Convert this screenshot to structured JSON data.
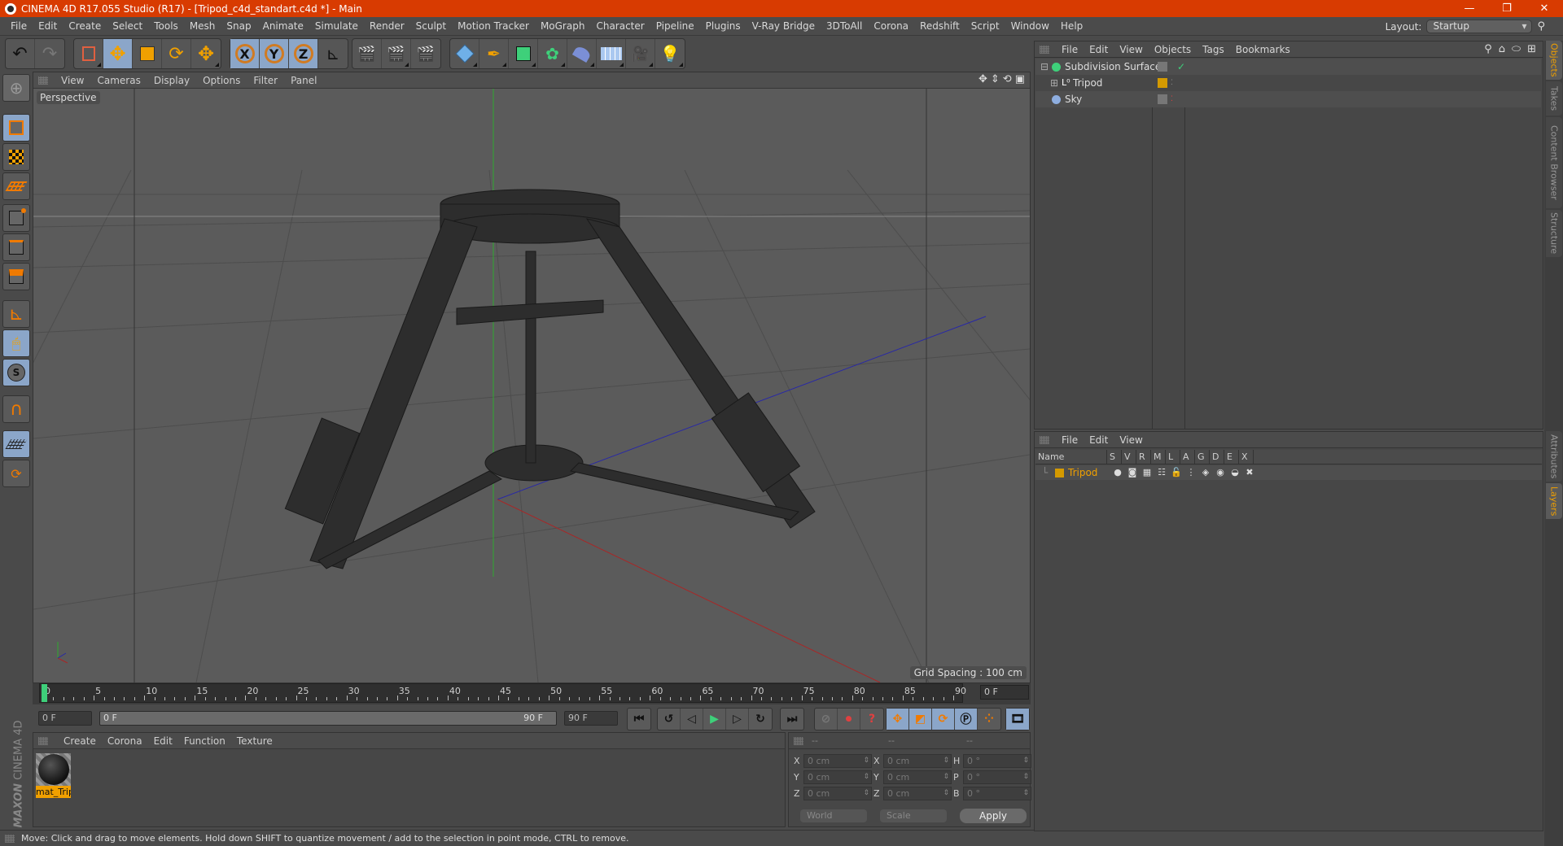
{
  "title": "CINEMA 4D R17.055 Studio (R17) - [Tripod_c4d_standart.c4d *] - Main",
  "window_controls": {
    "minimize": "—",
    "maximize": "❐",
    "close": "✕"
  },
  "menubar": [
    "File",
    "Edit",
    "Create",
    "Select",
    "Tools",
    "Mesh",
    "Snap",
    "Animate",
    "Simulate",
    "Render",
    "Sculpt",
    "Motion Tracker",
    "MoGraph",
    "Character",
    "Pipeline",
    "Plugins",
    "V-Ray Bridge",
    "3DToAll",
    "Corona",
    "Redshift",
    "Script",
    "Window",
    "Help"
  ],
  "layout": {
    "label": "Layout:",
    "value": "Startup"
  },
  "toolbar": {
    "axis_labels": [
      "X",
      "Y",
      "Z"
    ],
    "icons": [
      "undo-icon",
      "redo-icon",
      "live-selection-icon",
      "move-icon",
      "scale-icon",
      "rotate-icon",
      "recent-tool-icon",
      "x-axis-icon",
      "y-axis-icon",
      "z-axis-icon",
      "coordinate-system-icon",
      "render-view-icon",
      "render-picture-viewer-icon",
      "render-settings-icon",
      "cube-icon",
      "pen-spline-icon",
      "subdivision-surface-icon",
      "cloner-icon",
      "deformer-bend-icon",
      "floor-icon",
      "camera-icon",
      "light-icon"
    ]
  },
  "left_tools": [
    "make-editable-icon",
    "model-mode-icon",
    "texture-mode-icon",
    "workplane-mode-icon",
    "points-mode-icon",
    "edges-mode-icon",
    "polygons-mode-icon",
    "axis-mode-icon",
    "tweak-mode-icon",
    "solo-icon",
    "snapping-icon",
    "lock-workplane-icon",
    "workplane-icon"
  ],
  "viewport": {
    "menu": [
      "View",
      "Cameras",
      "Display",
      "Options",
      "Filter",
      "Panel"
    ],
    "camera_label": "Perspective",
    "grid_spacing": "Grid Spacing : 100 cm",
    "nav_icons": [
      "move-view-icon",
      "zoom-view-icon",
      "rotate-view-icon",
      "maximize-view-icon"
    ]
  },
  "timeline": {
    "ticks": [
      "0",
      "5",
      "10",
      "15",
      "20",
      "25",
      "30",
      "35",
      "40",
      "45",
      "50",
      "55",
      "60",
      "65",
      "70",
      "75",
      "80",
      "85",
      "90"
    ],
    "current_frame_field": "0 F",
    "start_field": "0 F",
    "range_start": "0 F",
    "range_end": "90 F",
    "end_field": "90 F",
    "current_frame": 0,
    "max_frame": 90
  },
  "transport": {
    "playback": [
      "go-to-start-icon",
      "previous-key-icon",
      "previous-frame-icon",
      "play-icon",
      "next-frame-icon",
      "next-key-icon",
      "go-to-end-icon"
    ],
    "record": [
      "autokey-icon",
      "record-icon",
      "keyframe-selection-icon"
    ],
    "key_modes": [
      "key-position-icon",
      "key-scale-icon",
      "key-rotation-icon",
      "key-parameter-icon",
      "key-pla-icon"
    ],
    "timeline_button": "timeline-icon"
  },
  "material_manager": {
    "menu": [
      "Create",
      "Corona",
      "Edit",
      "Function",
      "Texture"
    ],
    "materials": [
      {
        "name": "mat_Trip"
      }
    ]
  },
  "coordinates": {
    "headers": [
      "--",
      "--",
      "--"
    ],
    "rows": [
      {
        "l1": "X",
        "v1": "0 cm",
        "l2": "X",
        "v2": "0 cm",
        "l3": "H",
        "v3": "0 °"
      },
      {
        "l1": "Y",
        "v1": "0 cm",
        "l2": "Y",
        "v2": "0 cm",
        "l3": "P",
        "v3": "0 °"
      },
      {
        "l1": "Z",
        "v1": "0 cm",
        "l2": "Z",
        "v2": "0 cm",
        "l3": "B",
        "v3": "0 °"
      }
    ],
    "space": "World",
    "mode": "Scale",
    "apply": "Apply"
  },
  "brand": {
    "maxon": "MAXON",
    "product": "CINEMA 4D"
  },
  "status": "Move: Click and drag to move elements. Hold down SHIFT to quantize movement / add to the selection in point mode, CTRL to remove.",
  "object_manager": {
    "menu": [
      "File",
      "Edit",
      "View",
      "Objects",
      "Tags",
      "Bookmarks"
    ],
    "objects": [
      {
        "name": "Subdivision Surface",
        "icon": "subdivision-surface-icon",
        "expanded": true,
        "enabled": "✓"
      },
      {
        "name": "Tripod",
        "icon": "null-object-icon",
        "expanded": false,
        "layer_color": "#d49a00"
      },
      {
        "name": "Sky",
        "icon": "sky-icon"
      }
    ]
  },
  "layer_manager": {
    "menu": [
      "File",
      "Edit",
      "View"
    ],
    "columns": [
      "Name",
      "S",
      "V",
      "R",
      "M",
      "L",
      "A",
      "G",
      "D",
      "E",
      "X"
    ],
    "layers": [
      {
        "name": "Tripod",
        "color": "#d49a00"
      }
    ]
  },
  "right_tabs": {
    "top": [
      "Objects",
      "Takes",
      "Content Browser",
      "Structure"
    ],
    "bottom": [
      "Attributes",
      "Layers"
    ]
  },
  "colors": {
    "titlebar": "#d83b01",
    "accent": "#f0a000",
    "active_btn": "#8ba6c9"
  }
}
